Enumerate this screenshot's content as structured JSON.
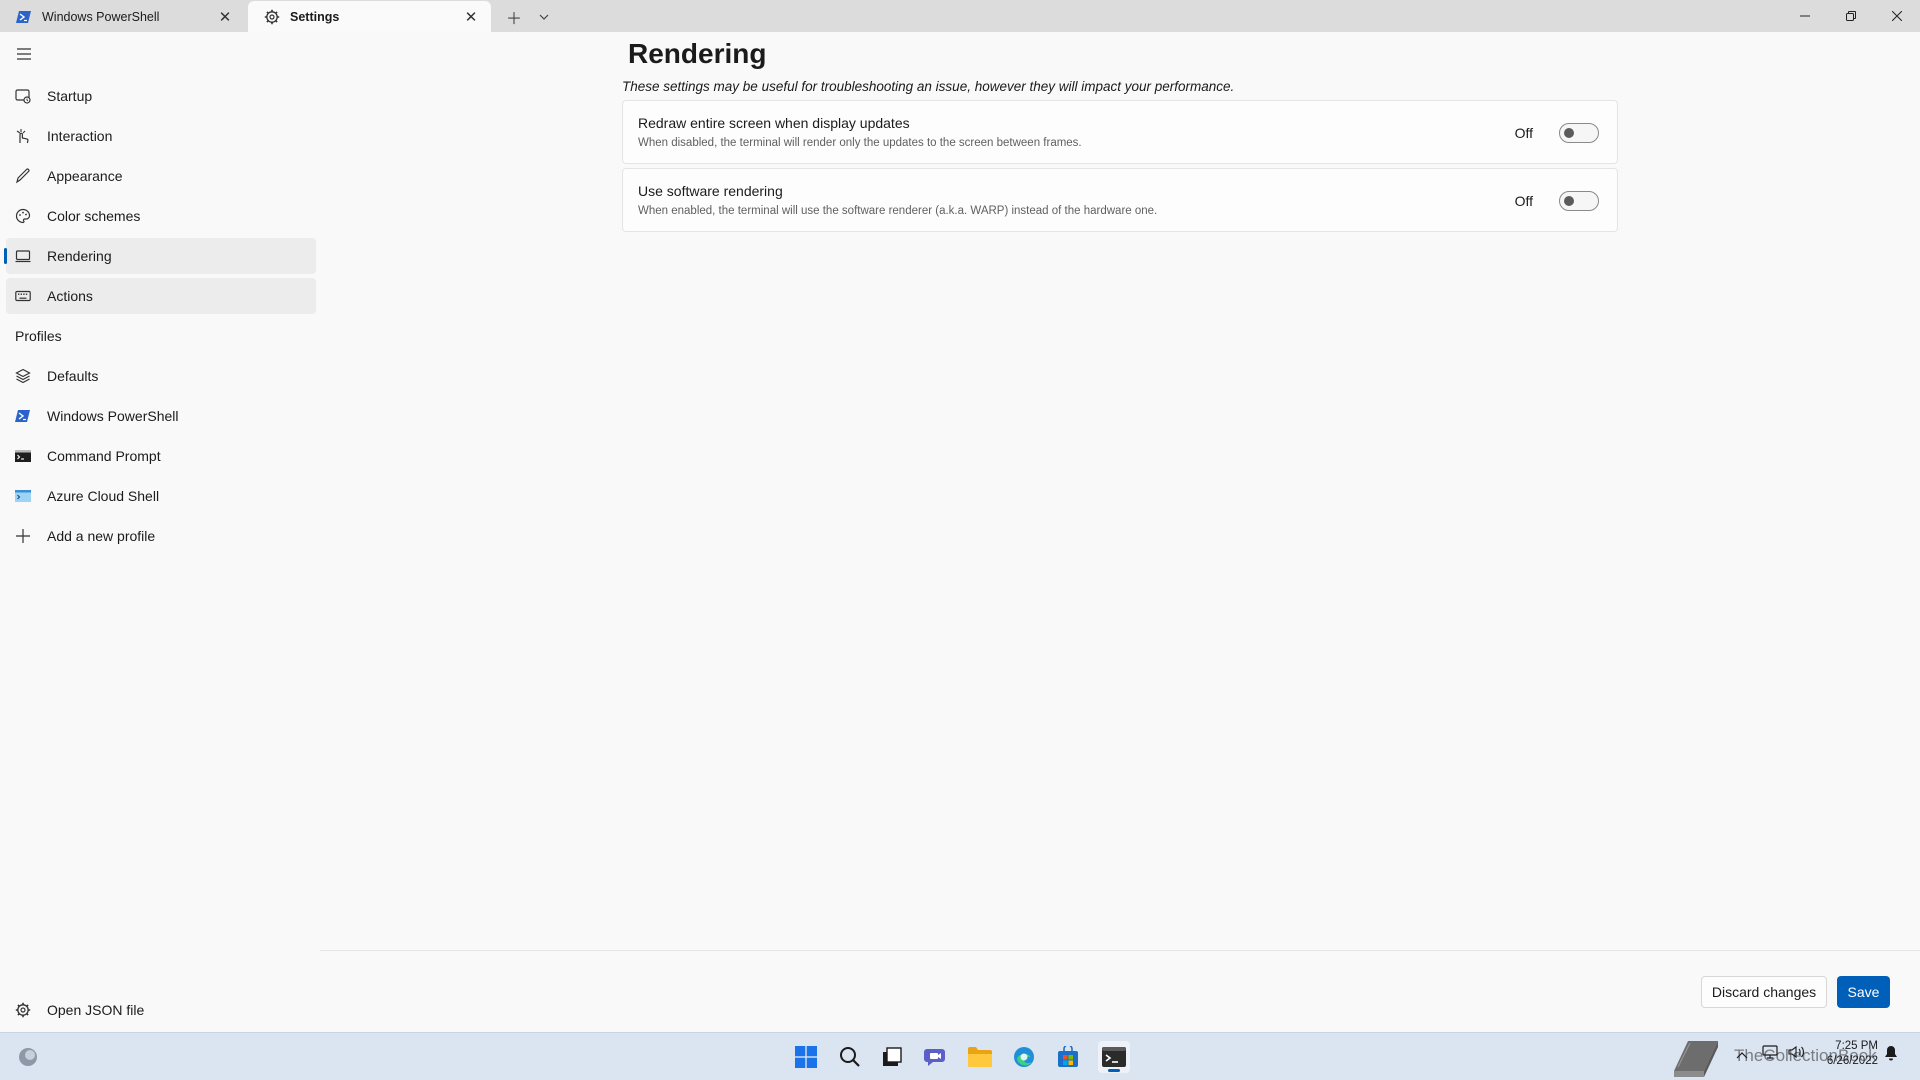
{
  "tabs": [
    {
      "label": "Windows PowerShell",
      "icon": "powershell-icon",
      "active": false
    },
    {
      "label": "Settings",
      "icon": "gear-icon",
      "active": true
    }
  ],
  "titlebar": {
    "new_tab_icon": "plus-icon",
    "dropdown_icon": "chevron-down-icon"
  },
  "sidebar": {
    "items": [
      {
        "label": "Startup",
        "icon": "startup-icon"
      },
      {
        "label": "Interaction",
        "icon": "interaction-icon"
      },
      {
        "label": "Appearance",
        "icon": "pen-icon"
      },
      {
        "label": "Color schemes",
        "icon": "palette-icon"
      },
      {
        "label": "Rendering",
        "icon": "monitor-icon",
        "selected": true
      },
      {
        "label": "Actions",
        "icon": "keyboard-icon"
      }
    ],
    "profiles_header": "Profiles",
    "profiles": [
      {
        "label": "Defaults",
        "icon": "layers-icon"
      },
      {
        "label": "Windows PowerShell",
        "icon": "powershell-icon"
      },
      {
        "label": "Command Prompt",
        "icon": "cmd-icon"
      },
      {
        "label": "Azure Cloud Shell",
        "icon": "azure-icon"
      },
      {
        "label": "Add a new profile",
        "icon": "plus-icon"
      }
    ],
    "open_json": "Open JSON file"
  },
  "main": {
    "title": "Rendering",
    "description": "These settings may be useful for troubleshooting an issue, however they will impact your performance.",
    "settings": [
      {
        "title": "Redraw entire screen when display updates",
        "description": "When disabled, the terminal will render only the updates to the screen between frames.",
        "state": "Off"
      },
      {
        "title": "Use software rendering",
        "description": "When enabled, the terminal will use the software renderer (a.k.a. WARP) instead of the hardware one.",
        "state": "Off"
      }
    ]
  },
  "footer": {
    "discard": "Discard changes",
    "save": "Save"
  },
  "taskbar": {
    "apps": [
      "start-icon",
      "search-icon",
      "task-view-icon",
      "chat-icon",
      "file-explorer-icon",
      "edge-icon",
      "store-icon",
      "terminal-icon"
    ],
    "time": "7:25 PM",
    "date": "6/26/2022",
    "watermark": "TheCollectionBook"
  },
  "colors": {
    "accent": "#005fb8",
    "taskbar": "#dbe4f1"
  }
}
